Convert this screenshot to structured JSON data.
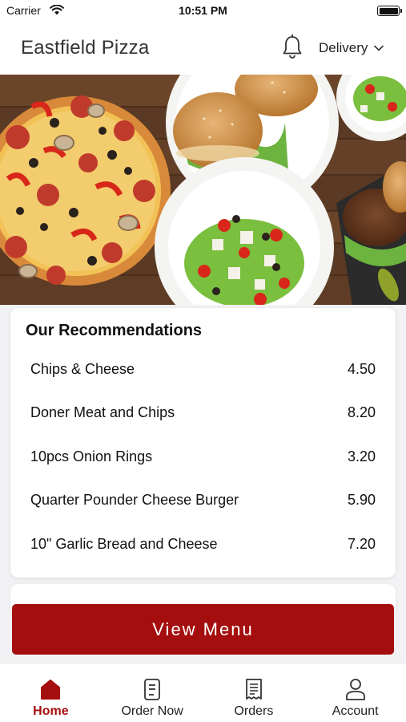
{
  "status_bar": {
    "carrier": "Carrier",
    "time": "10:51 PM"
  },
  "header": {
    "title": "Eastfield Pizza",
    "delivery_label": "Delivery"
  },
  "recommendations": {
    "title": "Our Recommendations",
    "items": [
      {
        "name": "Chips & Cheese",
        "price": "4.50"
      },
      {
        "name": "Doner Meat and Chips",
        "price": "8.20"
      },
      {
        "name": "10pcs Onion Rings",
        "price": "3.20"
      },
      {
        "name": "Quarter Pounder Cheese Burger",
        "price": "5.90"
      },
      {
        "name": "10\" Garlic Bread and Cheese",
        "price": "7.20"
      }
    ]
  },
  "view_menu_label": "View Menu",
  "tabs": [
    {
      "label": "Home",
      "icon": "home-icon",
      "active": true
    },
    {
      "label": "Order Now",
      "icon": "order-icon",
      "active": false
    },
    {
      "label": "Orders",
      "icon": "receipt-icon",
      "active": false
    },
    {
      "label": "Account",
      "icon": "person-icon",
      "active": false
    }
  ],
  "colors": {
    "accent": "#a50e0e",
    "background": "#f2f2f4"
  }
}
